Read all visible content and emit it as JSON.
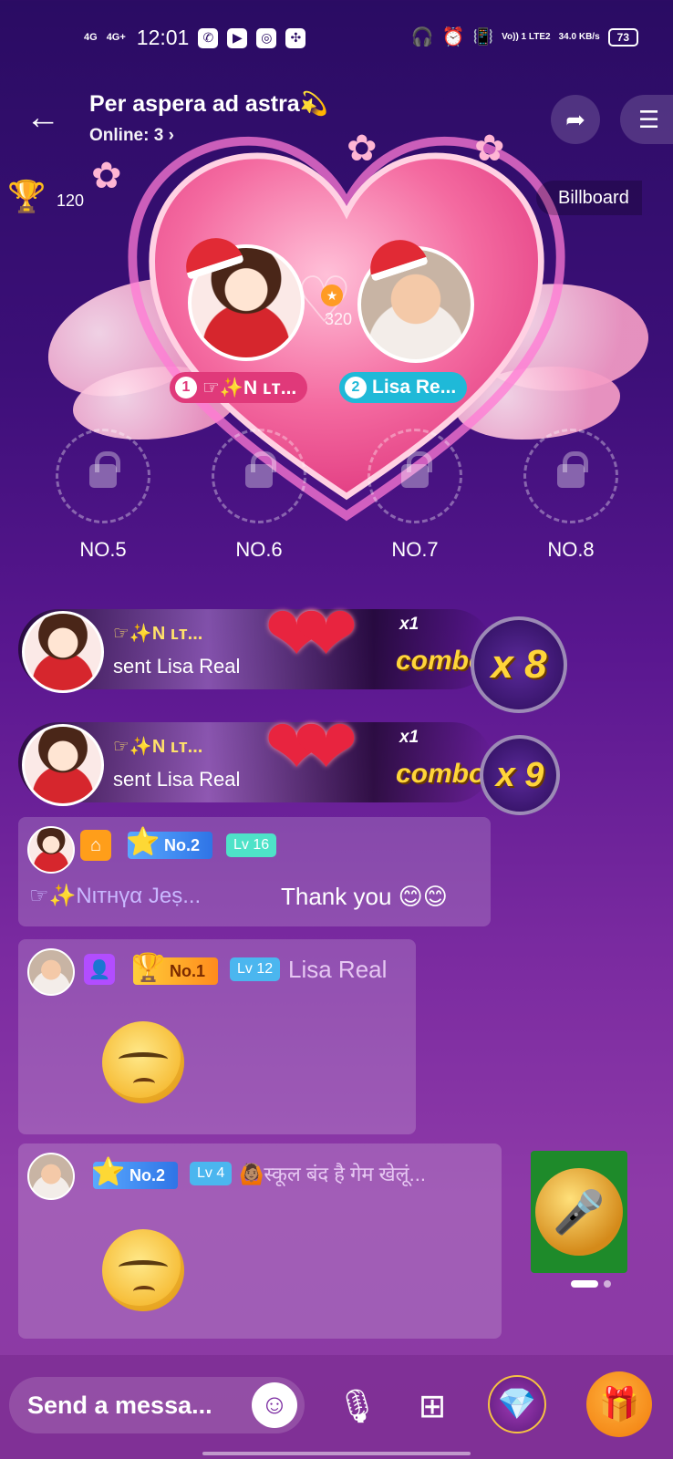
{
  "status_bar": {
    "net1": "4G",
    "net2": "4G+",
    "time": "12:01",
    "right_net": "Vo)) 1 LTE2",
    "speed": "34.0 KB/s",
    "battery": "73"
  },
  "header": {
    "title": "Per aspera ad astra💫",
    "online": "Online: 3 ›"
  },
  "top_info": {
    "trophy_score": "120",
    "billboard": "Billboard"
  },
  "stage": {
    "center_score": "320",
    "host1_tag_num": "1",
    "host1_tag": "☞✨N ʟᴛ...",
    "host2_tag_num": "2",
    "host2_tag": "Lisa Re...",
    "seats": [
      "NO.5",
      "NO.6",
      "NO.7",
      "NO.8"
    ]
  },
  "notifications": [
    {
      "sender": "☞✨N ʟᴛ...",
      "text": "sent  Lisa Real",
      "count": "x1",
      "combo_label": "combo",
      "combo_value": "x 8"
    },
    {
      "sender": "☞✨N ʟᴛ...",
      "text": "sent  Lisa Real",
      "count": "x1",
      "combo_label": "combo",
      "combo_value": "x 9"
    }
  ],
  "messages": [
    {
      "rank": "No.2",
      "level": "Lv 16",
      "sender": "☞✨Nιтнүα Jeṣ...",
      "text": "Thank you 😊😊"
    },
    {
      "rank": "No.1",
      "level": "Lv 12",
      "sender": "Lisa Real"
    },
    {
      "rank": "No.2",
      "level": "Lv 4",
      "sender": "🙆🏽स्कूल बंद है गेम खेलूं..."
    }
  ],
  "input": {
    "placeholder": "Send a messa..."
  },
  "colors": {
    "accent": "#f17b0a",
    "level_badge": "#4ee2c8",
    "rank_badge": "#2f74e6"
  },
  "icons": [
    "back-arrow-icon",
    "share-icon",
    "menu-icon",
    "trophy-icon",
    "lock-icon",
    "mic-off-icon",
    "grid-icon",
    "gem-icon",
    "gift-icon",
    "smile-icon"
  ]
}
